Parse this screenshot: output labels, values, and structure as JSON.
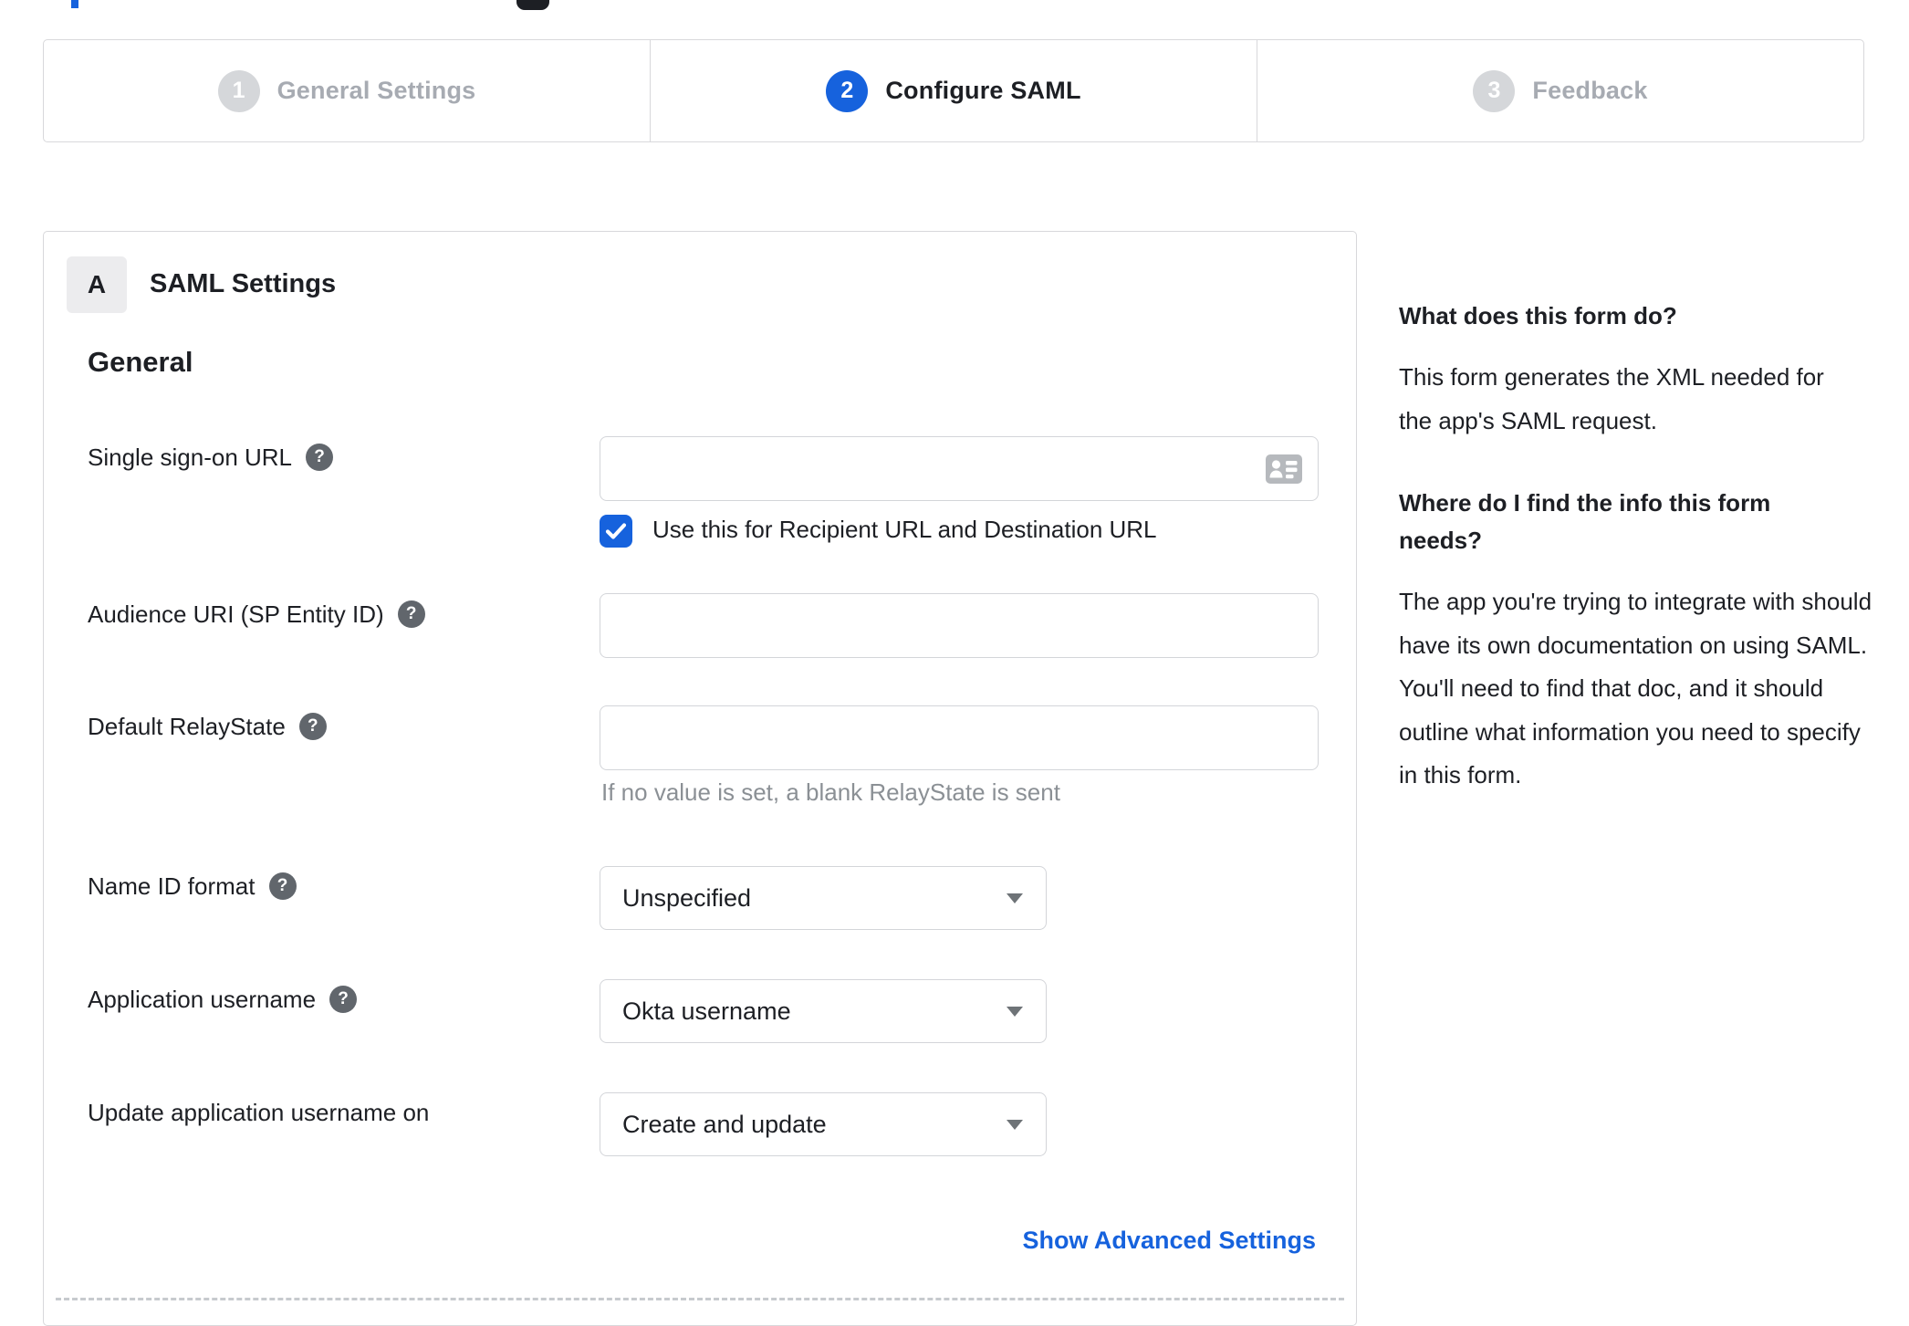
{
  "stepper": {
    "steps": [
      {
        "number": "1",
        "label": "General Settings"
      },
      {
        "number": "2",
        "label": "Configure SAML"
      },
      {
        "number": "3",
        "label": "Feedback"
      }
    ]
  },
  "form": {
    "badge": "A",
    "title": "SAML Settings",
    "section_heading": "General",
    "help_icon_glyph": "?",
    "sso_url": {
      "label": "Single sign-on URL",
      "value": "",
      "checkbox_label": "Use this for Recipient URL and Destination URL",
      "checkbox_checked": true
    },
    "audience_uri": {
      "label": "Audience URI (SP Entity ID)",
      "value": ""
    },
    "default_relaystate": {
      "label": "Default RelayState",
      "value": "",
      "helper": "If no value is set, a blank RelayState is sent"
    },
    "name_id_format": {
      "label": "Name ID format",
      "selected": "Unspecified"
    },
    "application_username": {
      "label": "Application username",
      "selected": "Okta username"
    },
    "update_application_username_on": {
      "label": "Update application username on",
      "selected": "Create and update"
    },
    "advanced_settings_link": "Show Advanced Settings"
  },
  "help_panel": {
    "heading_1": "What does this form do?",
    "body_1": "This form generates the XML needed for the app's SAML request.",
    "heading_2": "Where do I find the info this form needs?",
    "body_2": "The app you're trying to integrate with should have its own documentation on using SAML. You'll need to find that doc, and it should outline what information you need to specify in this form."
  },
  "colors": {
    "accent_blue": "#1662dd",
    "text_dark": "#1d1f24",
    "inactive_gray": "#a7abb2",
    "border_gray": "#d8d8db",
    "helper_gray": "#8b9095"
  }
}
